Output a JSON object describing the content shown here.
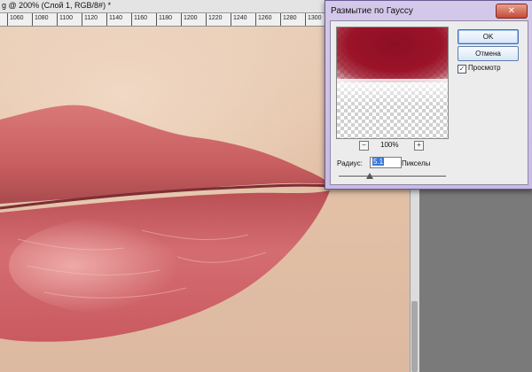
{
  "document": {
    "tab_title": "g @ 200% (Слой 1, RGB/8#) *"
  },
  "ruler": {
    "labels": [
      "1060",
      "1080",
      "1100",
      "1120",
      "1140",
      "1160",
      "1180",
      "1200",
      "1220",
      "1240",
      "1260",
      "1280",
      "1300"
    ]
  },
  "dialog": {
    "title": "Размытие по Гауссу",
    "close_symbol": "✕",
    "ok_label": "OK",
    "cancel_label": "Отмена",
    "preview_label": "Просмотр",
    "preview_checked": "✓",
    "zoom_out_symbol": "−",
    "zoom_in_symbol": "+",
    "zoom_value": "100%",
    "radius_label": "Радиус:",
    "radius_value": "5.1",
    "radius_unit": "Пикселы"
  },
  "colors": {
    "lip_red": "#c65a5a",
    "preview_red": "#9b1328",
    "dialog_frame": "#c7bbe4"
  },
  "icons": {
    "close": "close-icon",
    "checkbox": "checkmark-icon",
    "zoom_out": "zoom-out-icon",
    "zoom_in": "zoom-in-icon",
    "slider": "slider-thumb-icon"
  }
}
